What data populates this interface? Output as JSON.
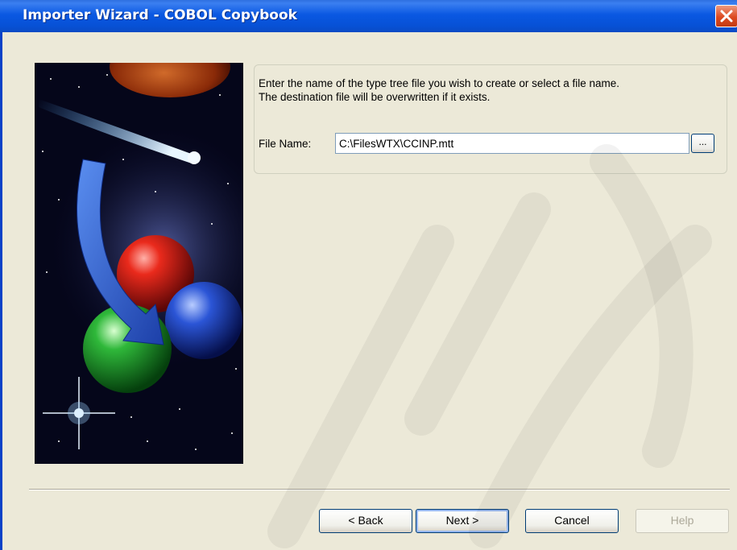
{
  "window": {
    "title": "Importer Wizard - COBOL Copybook"
  },
  "titlebar": {
    "close_icon": "close-icon"
  },
  "panel": {
    "instruction_line1": "Enter the name of the type tree file you wish to create or select a file name.",
    "instruction_line2": "The destination file will be overwritten if it exists.",
    "file_name_label": "File Name:",
    "file_name_value": "C:\\FilesWTX\\CCINP.mtt",
    "browse_label": "..."
  },
  "buttons": {
    "back": "< Back",
    "next": "Next >",
    "cancel": "Cancel",
    "help": "Help"
  },
  "colors": {
    "titlebar": "#0a58e2",
    "close": "#dd4a21",
    "dialog_bg": "#ece9d8"
  }
}
